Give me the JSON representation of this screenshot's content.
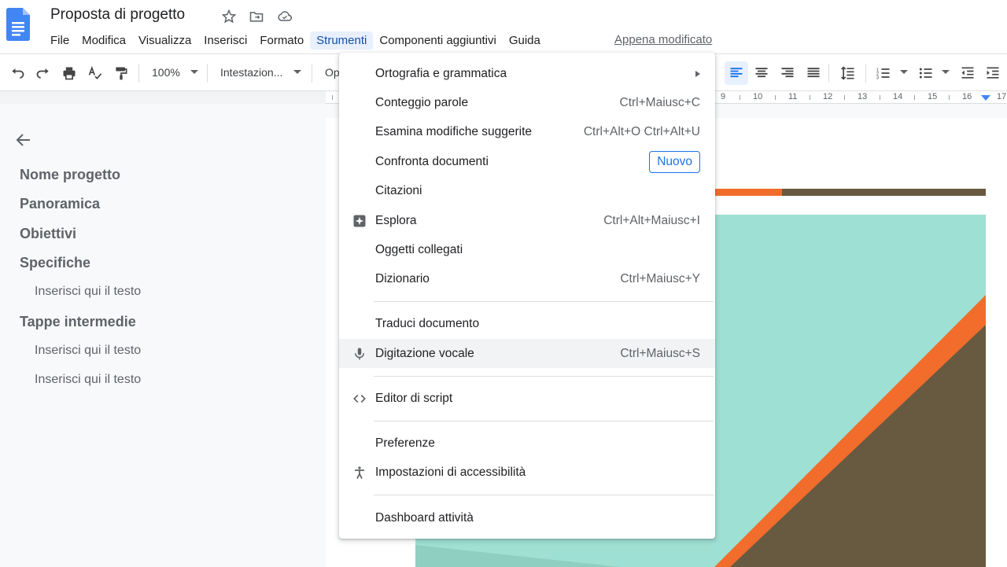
{
  "document": {
    "title": "Proposta di progetto",
    "last_edit": "Appena modificato"
  },
  "menubar": [
    "File",
    "Modifica",
    "Visualizza",
    "Inserisci",
    "Formato",
    "Strumenti",
    "Componenti aggiuntivi",
    "Guida"
  ],
  "active_menu": "Strumenti",
  "toolbar": {
    "zoom": "100%",
    "style": "Intestazion...",
    "font_partial": "Op"
  },
  "ruler": [
    "9",
    "10",
    "11",
    "12",
    "13",
    "14",
    "15",
    "16",
    "17"
  ],
  "outline": {
    "headings": [
      {
        "label": "Nome progetto",
        "level": 1
      },
      {
        "label": "Panoramica",
        "level": 1
      },
      {
        "label": "Obiettivi",
        "level": 1
      },
      {
        "label": "Specifiche",
        "level": 1
      },
      {
        "label": "Inserisci qui il testo",
        "level": 2
      },
      {
        "label": "Tappe intermedie",
        "level": 1
      },
      {
        "label": "Inserisci qui il testo",
        "level": 2
      },
      {
        "label": "Inserisci qui il testo",
        "level": 2
      }
    ]
  },
  "tools_menu": {
    "items": [
      {
        "label": "Ortografia e grammatica",
        "submenu": true
      },
      {
        "label": "Conteggio parole",
        "shortcut": "Ctrl+Maiusc+C"
      },
      {
        "label": "Esamina modifiche suggerite",
        "shortcut": "Ctrl+Alt+O Ctrl+Alt+U"
      },
      {
        "label": "Confronta documenti",
        "badge": "Nuovo"
      },
      {
        "label": "Citazioni"
      },
      {
        "label": "Esplora",
        "shortcut": "Ctrl+Alt+Maiusc+I",
        "icon": "explore-icon"
      },
      {
        "label": "Oggetti collegati"
      },
      {
        "label": "Dizionario",
        "shortcut": "Ctrl+Maiusc+Y"
      },
      {
        "label": "Traduci documento"
      },
      {
        "label": "Digitazione vocale",
        "shortcut": "Ctrl+Maiusc+S",
        "icon": "microphone-icon",
        "highlighted": true
      },
      {
        "label": "Editor di script",
        "icon": "code-icon"
      },
      {
        "label": "Preferenze"
      },
      {
        "label": "Impostazioni di accessibilità",
        "icon": "accessibility-icon"
      },
      {
        "label": "Dashboard attività"
      }
    ]
  },
  "colors": {
    "accent": "#1a73e8",
    "cover_teal": "#9ee0d3",
    "cover_orange": "#f26c2b",
    "cover_brown": "#675a40"
  }
}
